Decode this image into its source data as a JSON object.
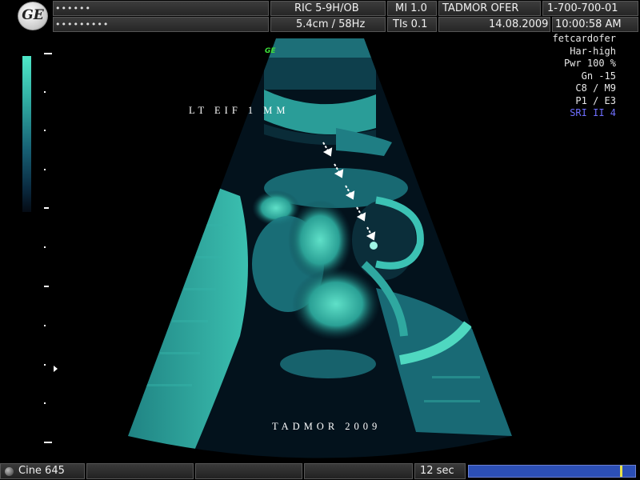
{
  "header": {
    "logo_text": "GE",
    "row1": {
      "patient_id": "••••••",
      "probe": "RIC 5-9H/OB",
      "mi": "MI  1.0",
      "operator": "TADMOR  OFER",
      "phone": "1-700-700-01"
    },
    "row2": {
      "patient_name": "•••••••••",
      "depth_freq": "5.4cm / 58Hz",
      "tis": "TIs  0.1",
      "date": "14.08.2009",
      "time": "10:00:58 AM"
    }
  },
  "params": [
    "fetcardofer",
    "Har-high",
    "Pwr 100 %",
    "Gn -15",
    "C8 / M9",
    "P1 / E3"
  ],
  "params_highlight": "SRI II 4",
  "image": {
    "small_logo": "GE",
    "annotation": "LT  EIF  1 MM",
    "signature": "TADMOR  2009"
  },
  "footer": {
    "cine_label": "Cine 645",
    "duration": "12 sec",
    "cine_position": 0.91
  },
  "colors": {
    "tissue": "#4fd8c0",
    "highlight_param": "#6f6fff",
    "cine_bar": "#2c4fb5",
    "cine_marker": "#e8e24a"
  }
}
